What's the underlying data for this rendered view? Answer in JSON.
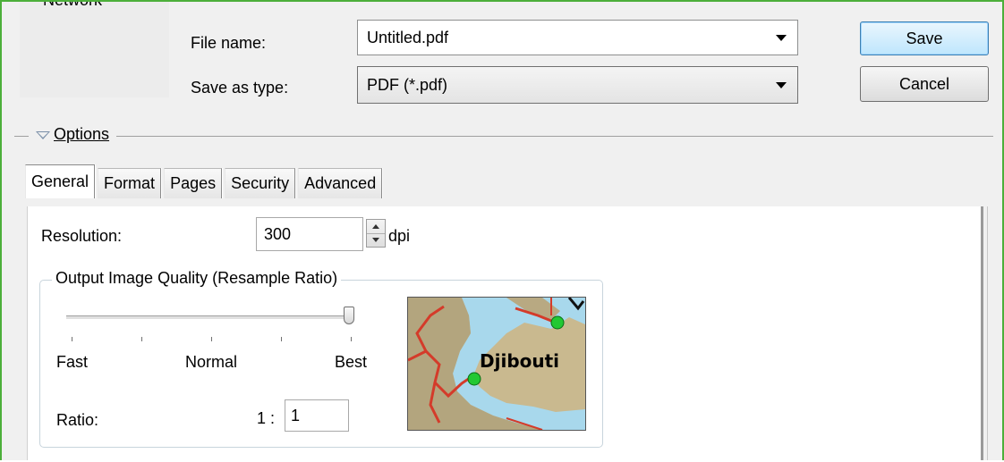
{
  "nav": {
    "partial_label": "Network"
  },
  "file_name": {
    "label": "File name:",
    "value": "Untitled.pdf"
  },
  "save_as_type": {
    "label": "Save as type:",
    "value": "PDF (*.pdf)"
  },
  "buttons": {
    "save": "Save",
    "cancel": "Cancel"
  },
  "options": {
    "label": "Options"
  },
  "tabs": [
    {
      "label": "General",
      "active": true
    },
    {
      "label": "Format",
      "active": false
    },
    {
      "label": "Pages",
      "active": false
    },
    {
      "label": "Security",
      "active": false
    },
    {
      "label": "Advanced",
      "active": false
    }
  ],
  "general": {
    "resolution_label": "Resolution:",
    "resolution_value": "300",
    "resolution_unit": "dpi",
    "quality_group_title": "Output Image Quality (Resample Ratio)",
    "slider": {
      "labels": [
        "Fast",
        "Normal",
        "Best"
      ],
      "tick_count": 5,
      "position": "Best",
      "level": 1.0
    },
    "ratio_label": "Ratio:",
    "ratio_prefix": "1 :",
    "ratio_value": "1",
    "preview_map_label": "Djibouti"
  },
  "colors": {
    "frame_border": "#4caf3a",
    "dialog_bg": "#f0f0f0",
    "map_water": "#a8d8ec",
    "map_land": "#c9b98f",
    "map_road": "#d43b2a",
    "map_city": "#22c833"
  },
  "icons": {
    "combo_dropdown": "chevron-down-icon",
    "options_toggle": "triangle-down-icon",
    "spinner": "spinner-arrows-icon"
  }
}
